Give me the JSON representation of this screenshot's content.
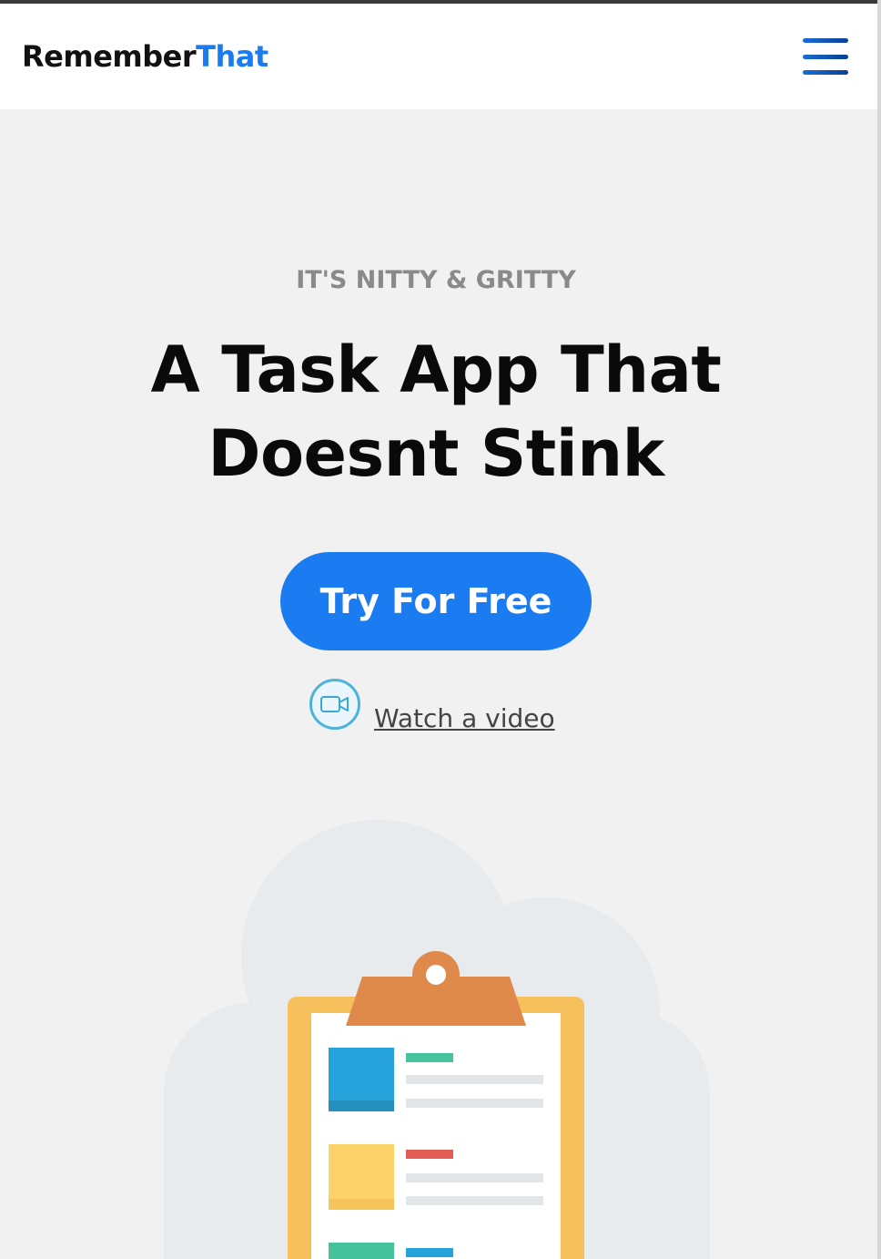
{
  "header": {
    "logo_part1": "Remember",
    "logo_part2": "That",
    "menu_icon": "hamburger-menu-icon"
  },
  "hero": {
    "eyebrow": "IT'S NITTY & GRITTY",
    "headline_line1": "A Task App That",
    "headline_line2": "Doesnt Stink",
    "cta_label": "Try For Free",
    "video_icon": "video-camera-icon",
    "video_link": "Watch a video"
  },
  "colors": {
    "brand_blue": "#1a7cf0",
    "background": "#f1f1f1",
    "eyebrow_gray": "#8a8a8a"
  },
  "illustration": {
    "name": "clipboard-checklist-illustration"
  }
}
